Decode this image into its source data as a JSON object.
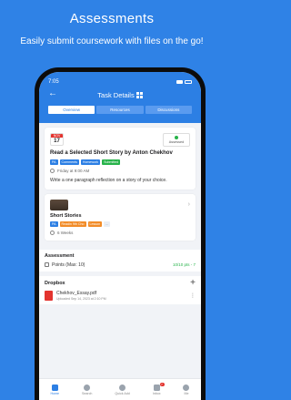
{
  "promo": {
    "title": "Assessments",
    "subtitle": "Easily submit coursework with files on the go!"
  },
  "status_bar": {
    "time": "7:05"
  },
  "header": {
    "title": "Task Details",
    "tabs": [
      {
        "label": "Overview",
        "active": true
      },
      {
        "label": "Resources",
        "active": false
      },
      {
        "label": "Discussions",
        "active": false
      }
    ]
  },
  "task": {
    "month": "NOV",
    "day": "17",
    "status": "Assessed",
    "title": "Read a Selected Short Story by Anton Chekhov",
    "badges": [
      "PA",
      "Comments",
      "Homework",
      "Submitted"
    ],
    "due": "Friday at 9:00 AM",
    "description": "Write a one paragraph reflection on a story of your choice."
  },
  "resource": {
    "title": "Short Stories",
    "badges": [
      "PA",
      "Readin 9th Cho",
      "Lesson",
      "..."
    ],
    "duration": "6 Weeks"
  },
  "assessment": {
    "title": "Assessment",
    "points_label": "Points (Max: 10)",
    "points_value": "10/10 pts - 7"
  },
  "dropbox": {
    "title": "Dropbox",
    "file_name": "Chekhov_Essay.pdf",
    "file_meta": "Uploaded Sep 14, 2023 at 2:10 PM"
  },
  "bottom_nav": [
    {
      "label": "Home",
      "active": true,
      "icon": "home-icon"
    },
    {
      "label": "Search",
      "active": false,
      "icon": "search-icon"
    },
    {
      "label": "Quick Add",
      "active": false,
      "icon": "plus-circle-icon"
    },
    {
      "label": "Inbox",
      "active": false,
      "icon": "inbox-icon",
      "badge": "7"
    },
    {
      "label": "Me",
      "active": false,
      "icon": "profile-icon"
    }
  ],
  "colors": {
    "brand": "#2f82e6",
    "success": "#27b34a",
    "alert": "#e3342f"
  }
}
